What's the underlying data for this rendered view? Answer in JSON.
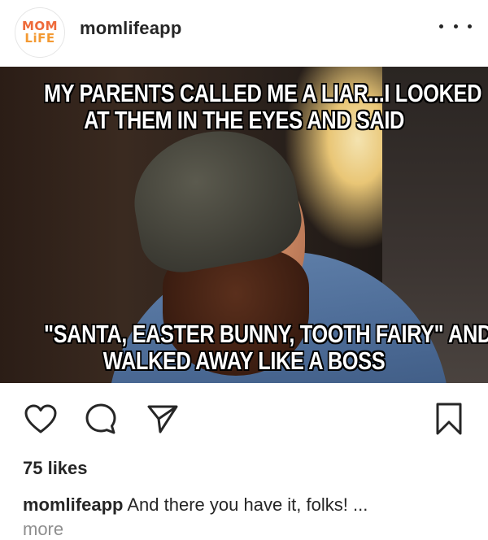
{
  "post": {
    "avatar_text_line1": "MOM",
    "avatar_text_line2": "LiFE",
    "username": "momlifeapp",
    "more_icon": "more-horizontal-icon",
    "image": {
      "caption_top": [
        "MY PARENTS CALLED ME A LIAR...I LOOKED",
        "AT THEM IN THE EYES AND SAID"
      ],
      "caption_bottom": [
        "\"SANTA, EASTER BUNNY, TOOTH FAIRY\" AND",
        "WALKED AWAY LIKE A BOSS"
      ]
    },
    "likes": "75 likes",
    "caption_user": "momlifeapp",
    "caption_text": "And there you have it, folks! ...",
    "more_label": "more"
  },
  "actions": {
    "like_icon": "heart-icon",
    "comment_icon": "comment-icon",
    "share_icon": "send-icon",
    "save_icon": "bookmark-icon"
  },
  "colors": {
    "text": "#262626",
    "muted": "#8e8e8e",
    "brand_orange": "#ee6a3a"
  }
}
